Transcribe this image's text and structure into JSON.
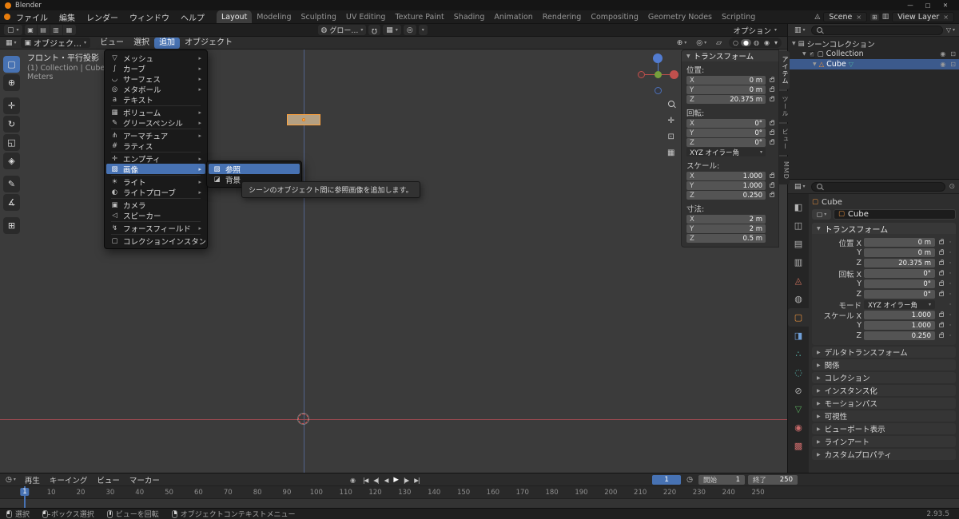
{
  "colors": {
    "accent": "#4772b3",
    "object_orange": "#e8913d",
    "selection_outline": "#ffa23d",
    "axis_x_red": "#9c4a50",
    "axis_z_blue": "#53638b"
  },
  "icons": {
    "mesh": "▽",
    "curve": "∫",
    "surface": "◡",
    "metaball": "◎",
    "text": "a",
    "volume": "▦",
    "gpencil": "✎",
    "armature": "⋔",
    "lattice": "#",
    "empty": "✛",
    "image": "▨",
    "image_bg": "◪",
    "light": "☀",
    "lightprobe": "◐",
    "camera": "▣",
    "speaker": "◁",
    "force": "↯",
    "collection": "▢",
    "scene_collection": "▤",
    "mesh_object": "△",
    "mesh_data": "▽",
    "dropdown": "▾",
    "submenu": "▸",
    "eye": "◉",
    "cam": "⊡",
    "tools": {
      "select-box": "▢",
      "cursor": "⊕",
      "move": "✛",
      "rotate": "↻",
      "scale": "◱",
      "transform": "◈",
      "annotate": "✎",
      "measure": "∡",
      "add-cube": "⊞"
    }
  },
  "title_bar": {
    "title": "Blender"
  },
  "top_bar": {
    "menus": [
      "ファイル",
      "編集",
      "レンダー",
      "ウィンドウ",
      "ヘルプ"
    ],
    "workspaces": [
      "Layout",
      "Modeling",
      "Sculpting",
      "UV Editing",
      "Texture Paint",
      "Shading",
      "Animation",
      "Rendering",
      "Compositing",
      "Geometry Nodes",
      "Scripting"
    ],
    "active_workspace": "Layout",
    "scene_label": "Scene",
    "view_layer_label": "View Layer"
  },
  "tool_settings": {
    "orientation": "グローバル",
    "options_label": "オプション"
  },
  "viewport": {
    "mode": "オブジェクトモード",
    "menus": [
      "ビュー",
      "選択",
      "追加",
      "オブジェクト"
    ],
    "active_menu": "追加",
    "overlay_lines": [
      "フロント・平行投影",
      "(1) Collection | Cube",
      "Meters"
    ],
    "tools": [
      {
        "name": "select-box"
      },
      {
        "name": "cursor"
      },
      {
        "name": "move"
      },
      {
        "name": "rotate"
      },
      {
        "name": "scale"
      },
      {
        "name": "transform"
      },
      {
        "name": "annotate"
      },
      {
        "name": "measure"
      },
      {
        "name": "add-cube"
      }
    ]
  },
  "add_menu": {
    "items": [
      {
        "label": "メッシュ",
        "icon": "mesh",
        "submenu": true
      },
      {
        "label": "カーブ",
        "icon": "curve",
        "submenu": true
      },
      {
        "label": "サーフェス",
        "icon": "surface",
        "submenu": true
      },
      {
        "label": "メタボール",
        "icon": "metaball",
        "submenu": true
      },
      {
        "label": "テキスト",
        "icon": "text",
        "submenu": false
      },
      {
        "sep": true
      },
      {
        "label": "ボリューム",
        "icon": "volume",
        "submenu": true
      },
      {
        "label": "グリースペンシル",
        "icon": "gpencil",
        "submenu": true
      },
      {
        "sep": true
      },
      {
        "label": "アーマチュア",
        "icon": "armature",
        "submenu": true
      },
      {
        "label": "ラティス",
        "icon": "lattice",
        "submenu": false
      },
      {
        "sep": true
      },
      {
        "label": "エンプティ",
        "icon": "empty",
        "submenu": true
      },
      {
        "label": "画像",
        "icon": "image",
        "submenu": true,
        "highlighted": true
      },
      {
        "sep": true
      },
      {
        "label": "ライト",
        "icon": "light",
        "submenu": true
      },
      {
        "label": "ライトプローブ",
        "icon": "lightprobe",
        "submenu": true
      },
      {
        "sep": true
      },
      {
        "label": "カメラ",
        "icon": "camera",
        "submenu": false
      },
      {
        "label": "スピーカー",
        "icon": "speaker",
        "submenu": false
      },
      {
        "sep": true
      },
      {
        "label": "フォースフィールド",
        "icon": "force",
        "submenu": true
      },
      {
        "sep": true
      },
      {
        "label": "コレクションインスタンス",
        "icon": "collection",
        "submenu": true
      }
    ]
  },
  "image_submenu": {
    "items": [
      {
        "label": "参照",
        "icon": "image",
        "highlighted": true
      },
      {
        "label": "背景",
        "icon": "image_bg",
        "highlighted": false
      }
    ]
  },
  "tooltip": {
    "text": "シーンのオブジェクト間に参照画像を追加します。"
  },
  "n_panel": {
    "tabs": [
      {
        "label": "アイテム",
        "active": true
      },
      {
        "label": "ツール"
      },
      {
        "label": "ビュー"
      },
      {
        "label": "MMD"
      }
    ],
    "section_title": "トランスフォーム",
    "groups": [
      {
        "label": "位置:",
        "rows": [
          {
            "axis": "X",
            "value": "0 m",
            "lock": true
          },
          {
            "axis": "Y",
            "value": "0 m",
            "lock": true
          },
          {
            "axis": "Z",
            "value": "20.375 m",
            "lock": true
          }
        ]
      },
      {
        "label": "回転:",
        "rows": [
          {
            "axis": "X",
            "value": "0°",
            "lock": true
          },
          {
            "axis": "Y",
            "value": "0°",
            "lock": true
          },
          {
            "axis": "Z",
            "value": "0°",
            "lock": true
          }
        ],
        "mode": "XYZ オイラー角"
      },
      {
        "label": "スケール:",
        "rows": [
          {
            "axis": "X",
            "value": "1.000",
            "lock": true
          },
          {
            "axis": "Y",
            "value": "1.000",
            "lock": true
          },
          {
            "axis": "Z",
            "value": "0.250",
            "lock": true
          }
        ]
      },
      {
        "label": "寸法:",
        "rows": [
          {
            "axis": "X",
            "value": "2 m"
          },
          {
            "axis": "Y",
            "value": "2 m"
          },
          {
            "axis": "Z",
            "value": "0.5 m"
          }
        ]
      }
    ]
  },
  "outliner": {
    "rows": [
      {
        "label": "シーンコレクション",
        "icon": "scene_collection",
        "depth": 0
      },
      {
        "label": "Collection",
        "icon": "collection",
        "depth": 1,
        "checkbox": true,
        "vis_icons": true
      },
      {
        "label": "Cube",
        "icon": "mesh_object",
        "data_icon": "mesh_data",
        "depth": 2,
        "selected": true,
        "vis_icons": true
      }
    ]
  },
  "properties": {
    "breadcrumb": "Cube",
    "name_value": "Cube",
    "tabs": [
      {
        "name": "tool",
        "glyph": "◧",
        "color": "#b5b5b5"
      },
      {
        "name": "render",
        "glyph": "◫",
        "color": "#b5b5b5"
      },
      {
        "name": "output",
        "glyph": "▤",
        "color": "#b5b5b5"
      },
      {
        "name": "view-layer",
        "glyph": "▥",
        "color": "#b5b5b5"
      },
      {
        "name": "scene",
        "glyph": "◬",
        "color": "#c9705c"
      },
      {
        "name": "world",
        "glyph": "◍",
        "color": "#b5b5b5"
      },
      {
        "name": "object",
        "glyph": "▢",
        "color": "#e8913d",
        "active": true
      },
      {
        "name": "modifiers",
        "glyph": "◨",
        "color": "#6f9fd8"
      },
      {
        "name": "particles",
        "glyph": "∴",
        "color": "#58b5ac"
      },
      {
        "name": "physics",
        "glyph": "◌",
        "color": "#58b5ac"
      },
      {
        "name": "constraints",
        "glyph": "⊘",
        "color": "#b5b5b5"
      },
      {
        "name": "object-data",
        "glyph": "▽",
        "color": "#58a85c"
      },
      {
        "name": "material",
        "glyph": "◉",
        "color": "#c96a6a"
      },
      {
        "name": "texture",
        "glyph": "▩",
        "color": "#c96a6a"
      }
    ],
    "transform_title": "トランスフォーム",
    "transform_rows": [
      {
        "label": "位置 X",
        "value": "0 m"
      },
      {
        "label": "Y",
        "value": "0 m"
      },
      {
        "label": "Z",
        "value": "20.375 m"
      },
      {
        "label": "回転 X",
        "value": "0°"
      },
      {
        "label": "Y",
        "value": "0°"
      },
      {
        "label": "Z",
        "value": "0°"
      },
      {
        "label": "モード",
        "value": "XYZ オイラー角",
        "dropdown": true
      },
      {
        "label": "スケール X",
        "value": "1.000"
      },
      {
        "label": "Y",
        "value": "1.000"
      },
      {
        "label": "Z",
        "value": "0.250"
      }
    ],
    "sections": [
      "デルタトランスフォーム",
      "関係",
      "コレクション",
      "インスタンス化",
      "モーションパス",
      "可視性",
      "ビューポート表示",
      "ラインアート",
      "カスタムプロパティ"
    ]
  },
  "timeline": {
    "menus": [
      "再生",
      "キーイング",
      "ビュー",
      "マーカー"
    ],
    "transport": [
      {
        "name": "jump-to-start",
        "glyph": "|◀"
      },
      {
        "name": "jump-to-prev-keyframe",
        "glyph": "◀|"
      },
      {
        "name": "play-reverse",
        "glyph": "◀"
      },
      {
        "name": "play",
        "glyph": "▶"
      },
      {
        "name": "jump-to-next-keyframe",
        "glyph": "|▶"
      },
      {
        "name": "jump-to-end",
        "glyph": "▶|"
      }
    ],
    "current_frame": "1",
    "start_label": "開始",
    "start_value": "1",
    "end_label": "終了",
    "end_value": "250",
    "ruler_frames": [
      1,
      10,
      20,
      30,
      40,
      50,
      60,
      70,
      80,
      90,
      100,
      110,
      120,
      130,
      140,
      150,
      160,
      170,
      180,
      190,
      200,
      210,
      220,
      230,
      240,
      250
    ]
  },
  "status_bar": {
    "hints": [
      {
        "button": "lmb",
        "label": "選択"
      },
      {
        "button": "lmb-drag",
        "label": "ボックス選択"
      },
      {
        "button": "mmb",
        "label": "ビューを回転"
      },
      {
        "button": "rmb",
        "label": "オブジェクトコンテキストメニュー"
      }
    ],
    "version": "2.93.5"
  }
}
